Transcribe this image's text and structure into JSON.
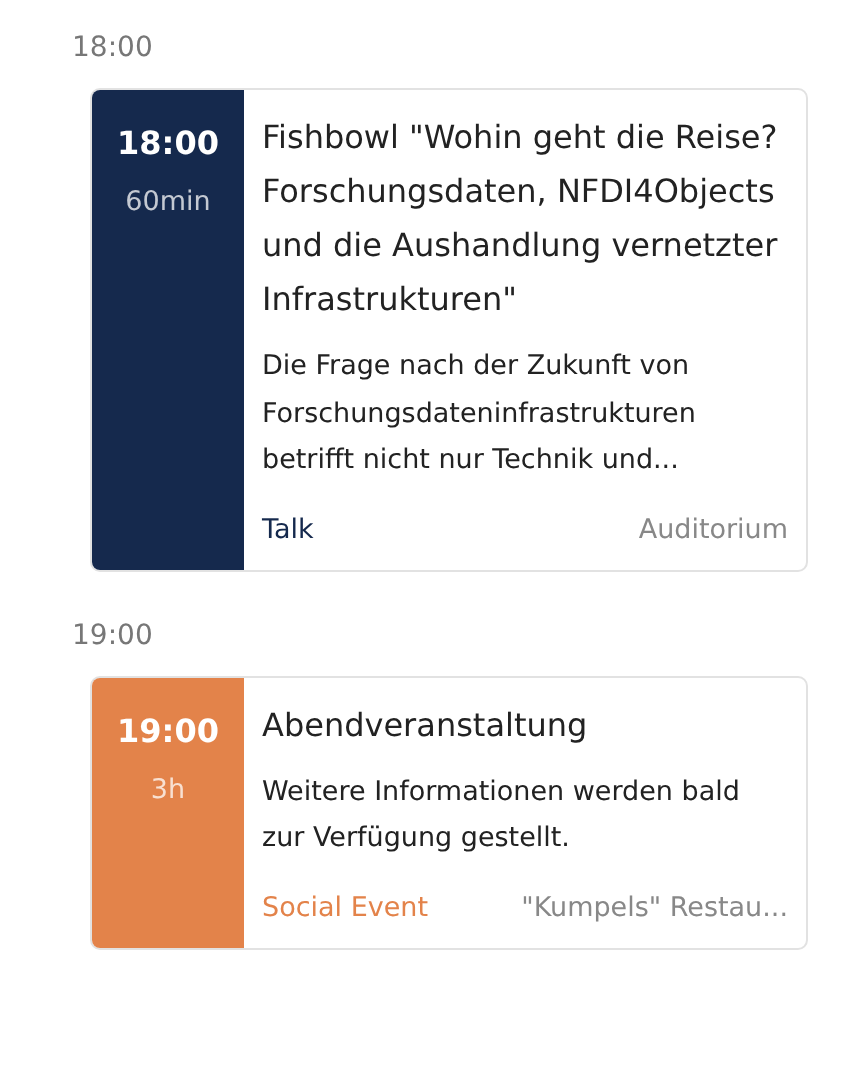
{
  "slots": [
    {
      "time": "18:00",
      "sessions": [
        {
          "start": "18:00",
          "duration": "60min",
          "color": "#15294d",
          "title": "Fishbowl \"Wohin geht die Reise? Forschungsdaten, NFDI4Objects und die Aushandlung vernetzter Infrastrukturen\"",
          "description": "Die Frage nach der Zukunft von Forschungsdateninfrastrukturen betrifft nicht nur Technik und...",
          "category": "Talk",
          "location": "Auditorium"
        }
      ]
    },
    {
      "time": "19:00",
      "sessions": [
        {
          "start": "19:00",
          "duration": "3h",
          "color": "#e3834a",
          "title": "Abendveranstaltung",
          "description": "Weitere Informationen werden bald zur Verfügung gestellt.",
          "category": "Social Event",
          "location": "\"Kumpels\" Restau..."
        }
      ]
    }
  ]
}
